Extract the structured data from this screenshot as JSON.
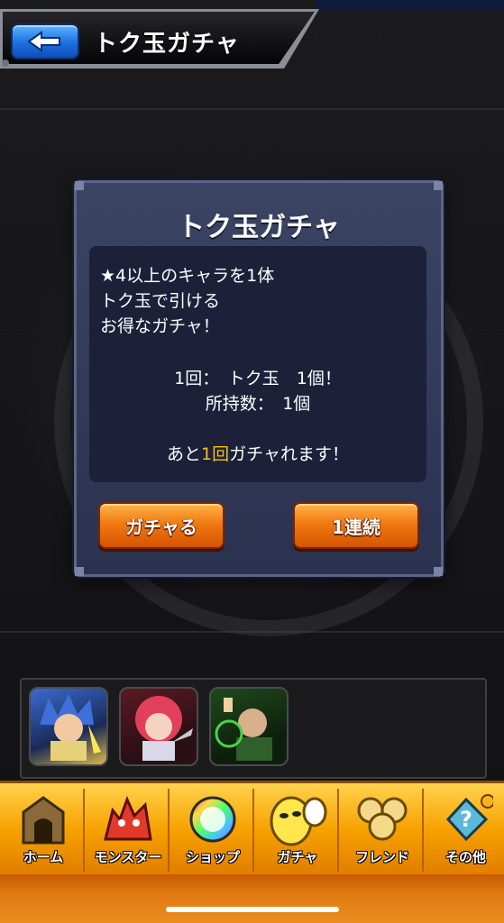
{
  "header": {
    "title": "トク玉ガチャ"
  },
  "dialog": {
    "title": "トク玉ガチャ",
    "description_lines": [
      "★4以上のキャラを1体",
      "トク玉で引ける",
      "お得なガチャ！"
    ],
    "cost_line": "1回：　トク玉　1個！",
    "owned_line": "所持数：　1個",
    "remaining_prefix": "あと",
    "remaining_count": "1回",
    "remaining_suffix": "ガチャれます！",
    "primary_button": "ガチャる",
    "secondary_button": "1連続"
  },
  "nav": {
    "items": [
      {
        "label": "ホーム"
      },
      {
        "label": "モンスター"
      },
      {
        "label": "ショップ"
      },
      {
        "label": "ガチャ"
      },
      {
        "label": "フレンド"
      },
      {
        "label": "その他"
      }
    ]
  },
  "colors": {
    "accent_orange": "#f07a12",
    "highlight_yellow": "#f5c021",
    "dialog_bg": "#3b4463",
    "back_blue": "#1b6fe0"
  }
}
